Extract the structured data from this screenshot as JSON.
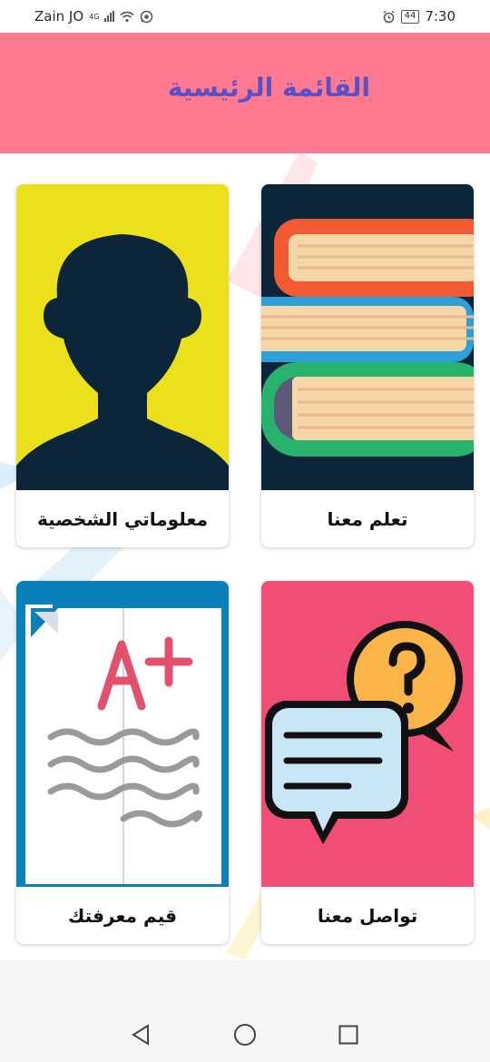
{
  "status_bar": {
    "carrier": "Zain JO",
    "network": "4G",
    "battery": "44",
    "time": "7:30"
  },
  "header": {
    "title": "القائمة الرئيسية"
  },
  "cards": [
    {
      "label": "تعلم معنا",
      "image": "books-icon"
    },
    {
      "label": "معلوماتي الشخصية",
      "image": "user-silhouette-icon"
    },
    {
      "label": "تواصل معنا",
      "image": "chat-bubbles-icon"
    },
    {
      "label": "قيم معرفتك",
      "image": "graded-paper-icon"
    }
  ],
  "colors": {
    "header_bg": "#ff7a91",
    "title_color": "#5b4fc7",
    "books_bg": "#0d2538",
    "profile_bg": "#ecdf1c",
    "contact_bg": "#f04e74",
    "quiz_bg": "#0a80b8"
  },
  "nav": {
    "back": "back-icon",
    "home": "home-icon",
    "recents": "recents-icon"
  }
}
